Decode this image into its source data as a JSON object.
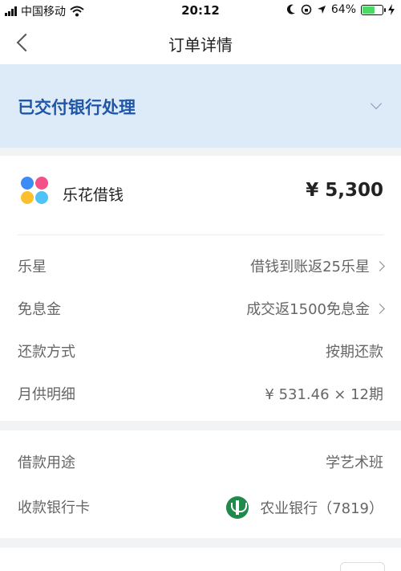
{
  "status_bar": {
    "carrier": "中国移动",
    "time": "20:12",
    "battery_percent": "64%",
    "battery_level": 0.64,
    "icons": [
      "signal-icon",
      "wifi-icon",
      "moon-icon",
      "lock-rotation-icon",
      "location-arrow-icon",
      "battery-icon",
      "charging-icon"
    ]
  },
  "nav": {
    "title": "订单详情"
  },
  "banner": {
    "status_text": "已交付银行处理"
  },
  "product": {
    "name": "乐花借钱",
    "amount": "¥ 5,300"
  },
  "details": [
    {
      "label": "乐星",
      "value": "借钱到账返25乐星",
      "has_arrow": true
    },
    {
      "label": "免息金",
      "value": "成交返1500免息金",
      "has_arrow": true
    },
    {
      "label": "还款方式",
      "value": "按期还款",
      "has_arrow": false
    },
    {
      "label": "月供明细",
      "value": "¥ 531.46 × 12期",
      "has_arrow": false
    }
  ],
  "loan_info": [
    {
      "label": "借款用途",
      "value": "学艺术班"
    },
    {
      "label": "收款银行卡",
      "value": "农业银行（7819）"
    }
  ],
  "colors": {
    "banner_bg": "#ddeaf8",
    "banner_text": "#1f56a6",
    "bank_green": "#1f8a4c",
    "battery_green": "#4cd964"
  }
}
